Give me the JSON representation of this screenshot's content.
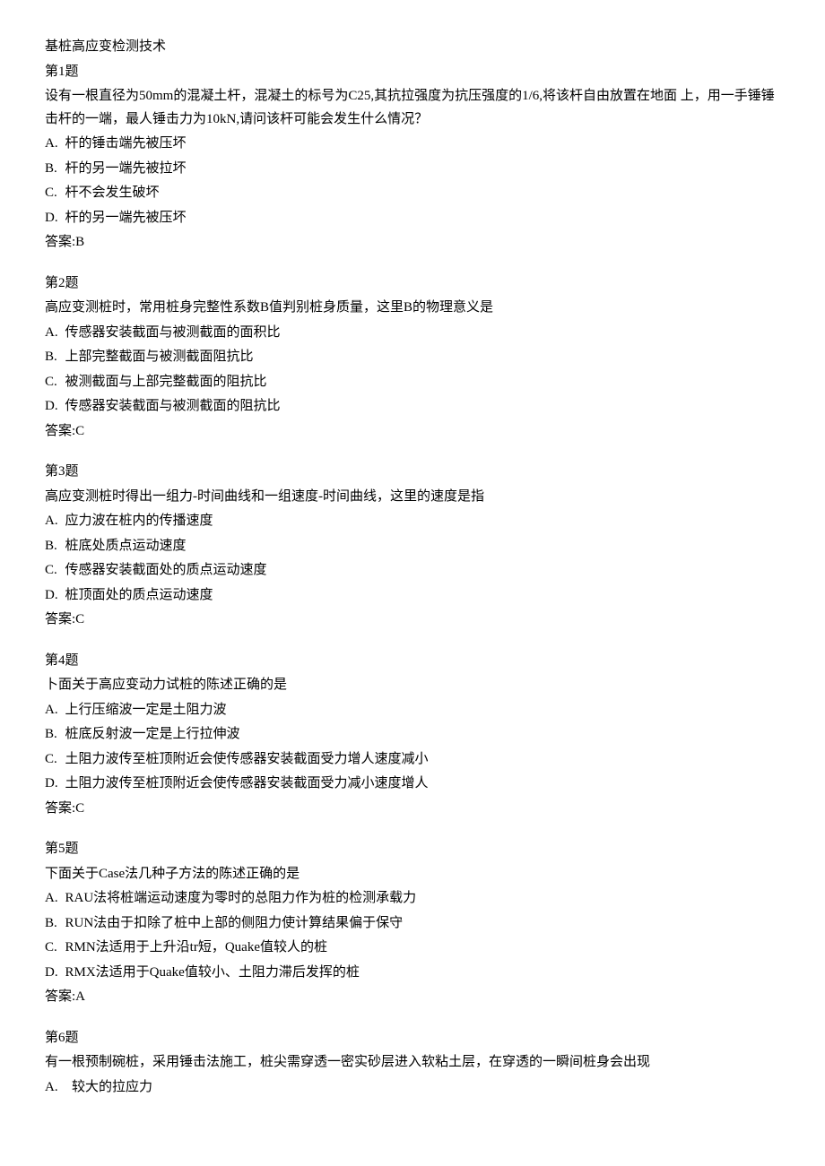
{
  "title": "基桩高应变检测技术",
  "questions": [
    {
      "heading": "第1题",
      "text": "设有一根直径为50mm的混凝土杆，混凝土的标号为C25,其抗拉强度为抗压强度的1/6,将该杆自由放置在地面 上，用一手锤锤击杆的一端，最人锤击力为10kN,请问该杆可能会发生什么情况？",
      "options": [
        {
          "label": "A.",
          "text": "杆的锤击端先被压坏"
        },
        {
          "label": "B.",
          "text": "杆的另一端先被拉坏"
        },
        {
          "label": "C.",
          "text": "杆不会发生破坏"
        },
        {
          "label": "D.",
          "text": "杆的另一端先被压坏"
        }
      ],
      "answer_label": "答案:",
      "answer_value": "B"
    },
    {
      "heading": "第2题",
      "text": "高应变测桩时，常用桩身完整性系数B值判别桩身质量，这里B的物理意义是",
      "options": [
        {
          "label": "A.",
          "text": "传感器安装截面与被测截面的面积比"
        },
        {
          "label": "B.",
          "text": "上部完整截面与被测截面阻抗比"
        },
        {
          "label": "C.",
          "text": "被测截面与上部完整截面的阻抗比"
        },
        {
          "label": "D.",
          "text": "传感器安装截面与被测截面的阻抗比"
        }
      ],
      "answer_label": "答案:",
      "answer_value": "C"
    },
    {
      "heading": "第3题",
      "text": "高应变测桩时得出一组力-时间曲线和一组速度-时间曲线，这里的速度是指",
      "options": [
        {
          "label": "A.",
          "text": "应力波在桩内的传播速度"
        },
        {
          "label": "B.",
          "text": "桩底处质点运动速度"
        },
        {
          "label": "C.",
          "text": "传感器安装截面处的质点运动速度"
        },
        {
          "label": "D.",
          "text": "桩顶面处的质点运动速度"
        }
      ],
      "answer_label": "答案:",
      "answer_value": "C"
    },
    {
      "heading": "第4题",
      "text": "卜面关于高应变动力试桩的陈述正确的是",
      "options": [
        {
          "label": "A.",
          "text": "上行压缩波一定是土阻力波"
        },
        {
          "label": "B.",
          "text": "桩底反射波一定是上行拉伸波"
        },
        {
          "label": "C.",
          "text": "土阻力波传至桩顶附近会使传感器安装截面受力增人速度减小"
        },
        {
          "label": "D.",
          "text": "土阻力波传至桩顶附近会使传感器安装截面受力减小速度增人"
        }
      ],
      "answer_label": "答案:",
      "answer_value": "C"
    },
    {
      "heading": "第5题",
      "text": "下面关于Case法几种子方法的陈述正确的是",
      "options": [
        {
          "label": "A.",
          "text": "RAU法将桩端运动速度为零时的总阻力作为桩的检测承载力"
        },
        {
          "label": "B.",
          "text": "RUN法由于扣除了桩中上部的侧阻力使计算结果偏于保守"
        },
        {
          "label": "C.",
          "text": "RMN法适用于上升沿tr短，Quake值较人的桩"
        },
        {
          "label": "D.",
          "text": "RMX法适用于Quake值较小、土阻力滞后发挥的桩"
        }
      ],
      "answer_label": "答案:",
      "answer_value": "A"
    },
    {
      "heading": "第6题",
      "text": "有一根预制碗桩，采用锤击法施工，桩尖需穿透一密实砂层进入软粘土层，在穿透的一瞬间桩身会出现",
      "options": [
        {
          "label": "A.",
          "text": "较大的拉应力"
        }
      ],
      "answer_label": "",
      "answer_value": ""
    }
  ]
}
